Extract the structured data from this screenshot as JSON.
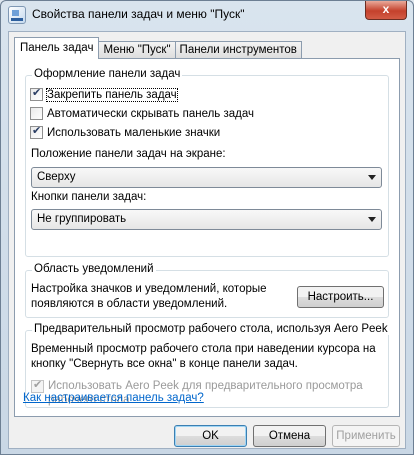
{
  "window": {
    "title": "Свойства панели задач и меню \"Пуск\"",
    "close_label": "x"
  },
  "tabs": [
    {
      "label": "Панель задач",
      "active": true
    },
    {
      "label": "Меню \"Пуск\"",
      "active": false
    },
    {
      "label": "Панели инструментов",
      "active": false
    }
  ],
  "taskbar_group": {
    "title": "Оформление панели задач",
    "lock_taskbar": {
      "label": "Закрепить панель задач",
      "checked": true
    },
    "auto_hide": {
      "label": "Автоматически скрывать панель задач",
      "checked": false
    },
    "small_icons": {
      "label": "Использовать маленькие значки",
      "checked": true
    },
    "location_label": "Положение панели задач на экране:",
    "location_value": "Сверху",
    "buttons_label": "Кнопки панели задач:",
    "buttons_value": "Не группировать"
  },
  "notification_group": {
    "title": "Область уведомлений",
    "description_line1": "Настройка значков и уведомлений, которые",
    "description_line2": "появляются в области уведомлений.",
    "customize_button": "Настроить..."
  },
  "aero_group": {
    "title": "Предварительный просмотр рабочего стола, используя Aero Peek",
    "description_line1": "Временный просмотр рабочего стола при наведении курсора на",
    "description_line2": "кнопку \"Свернуть все окна\" в конце панели задач.",
    "checkbox_line1": "Использовать Aero Peek для предварительного просмотра",
    "checkbox_line2": "рабочего стола",
    "checked": true,
    "enabled": false
  },
  "help_link": "Как настраивается панель задач?",
  "buttons": {
    "ok": "OK",
    "cancel": "Отмена",
    "apply": "Применить"
  }
}
